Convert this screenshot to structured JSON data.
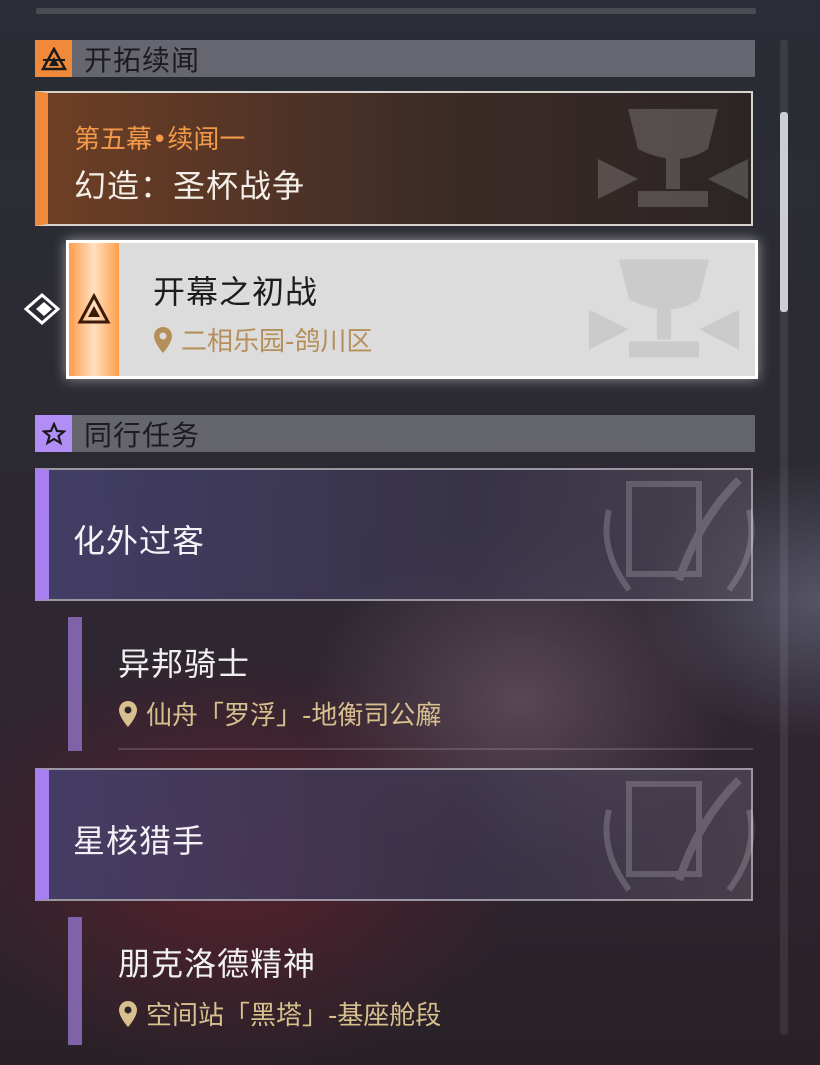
{
  "trailblaze": {
    "header": "开拓续闻",
    "chapter_sub": "第五幕•续闻一",
    "chapter_title": "幻造：圣杯战争",
    "active_quest": {
      "title": "开幕之初战",
      "location": "二相乐园-鸽川区"
    }
  },
  "companion": {
    "header": "同行任务",
    "groups": [
      {
        "title": "化外过客",
        "quest": {
          "title": "异邦骑士",
          "location": "仙舟「罗浮」-地衡司公廨"
        }
      },
      {
        "title": "星核猎手",
        "quest": {
          "title": "朋克洛德精神",
          "location": "空间站「黑塔」-基座舱段"
        }
      }
    ]
  },
  "icons": {
    "trailblaze": "triangle-eye-icon",
    "companion": "star-icon",
    "location": "location-pin-icon",
    "pointer": "diamond-pointer-icon"
  },
  "colors": {
    "trailblaze_accent": "#f08a3a",
    "companion_accent": "#a77ff0",
    "location_text": "#d8bf8e"
  }
}
